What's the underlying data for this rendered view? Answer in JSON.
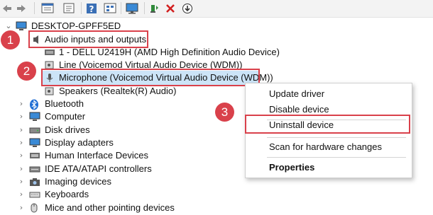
{
  "toolbar": {
    "icons": [
      "back-arrow-icon",
      "forward-arrow-icon",
      "properties-grid-icon",
      "document-icon",
      "help-icon",
      "grid-view-icon",
      "monitor-icon",
      "update-driver-icon",
      "delete-x-icon",
      "download-icon"
    ]
  },
  "tree": {
    "root": "DESKTOP-GPFF5ED",
    "audio_group": "Audio inputs and outputs",
    "audio_children": [
      "1 - DELL U2419H (AMD High Definition Audio Device)",
      "Line (Voicemod Virtual Audio Device (WDM))",
      "Microphone (Voicemod Virtual Audio Device (WDM))",
      "Speakers (Realtek(R) Audio)"
    ],
    "categories": [
      "Bluetooth",
      "Computer",
      "Disk drives",
      "Display adapters",
      "Human Interface Devices",
      "IDE ATA/ATAPI controllers",
      "Imaging devices",
      "Keyboards",
      "Mice and other pointing devices"
    ]
  },
  "callouts": [
    "1",
    "2",
    "3"
  ],
  "context_menu": {
    "items": [
      "Update driver",
      "Disable device",
      "Uninstall device",
      "Scan for hardware changes",
      "Properties"
    ]
  },
  "colors": {
    "highlight_red": "#d9414b",
    "selection_blue": "#cce4f7"
  }
}
